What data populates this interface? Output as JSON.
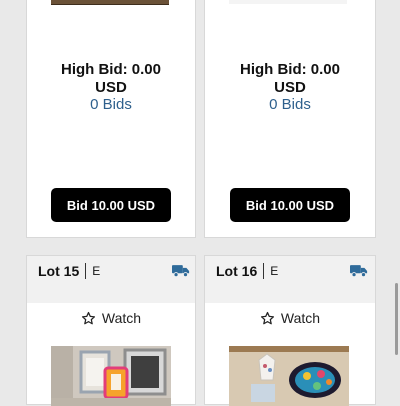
{
  "lots": [
    {
      "high_bid_label": "High Bid: 0.00",
      "currency": "USD",
      "bids_label": "0 Bids",
      "bid_button_label": "Bid 10.00 USD"
    },
    {
      "high_bid_label": "High Bid: 0.00",
      "currency": "USD",
      "bids_label": "0 Bids",
      "bid_button_label": "Bid 10.00 USD"
    },
    {
      "lot_label": "Lot 15",
      "lot_code": "E",
      "watch_label": "Watch",
      "shipping_icon": "truck-icon",
      "watch_icon": "star-outline-icon"
    },
    {
      "lot_label": "Lot 16",
      "lot_code": "E",
      "watch_label": "Watch",
      "shipping_icon": "truck-icon",
      "watch_icon": "star-outline-icon"
    }
  ],
  "colors": {
    "bids_link": "#2d5f8c",
    "shipping_icon": "#2f6b9a",
    "button_bg": "#000000"
  }
}
